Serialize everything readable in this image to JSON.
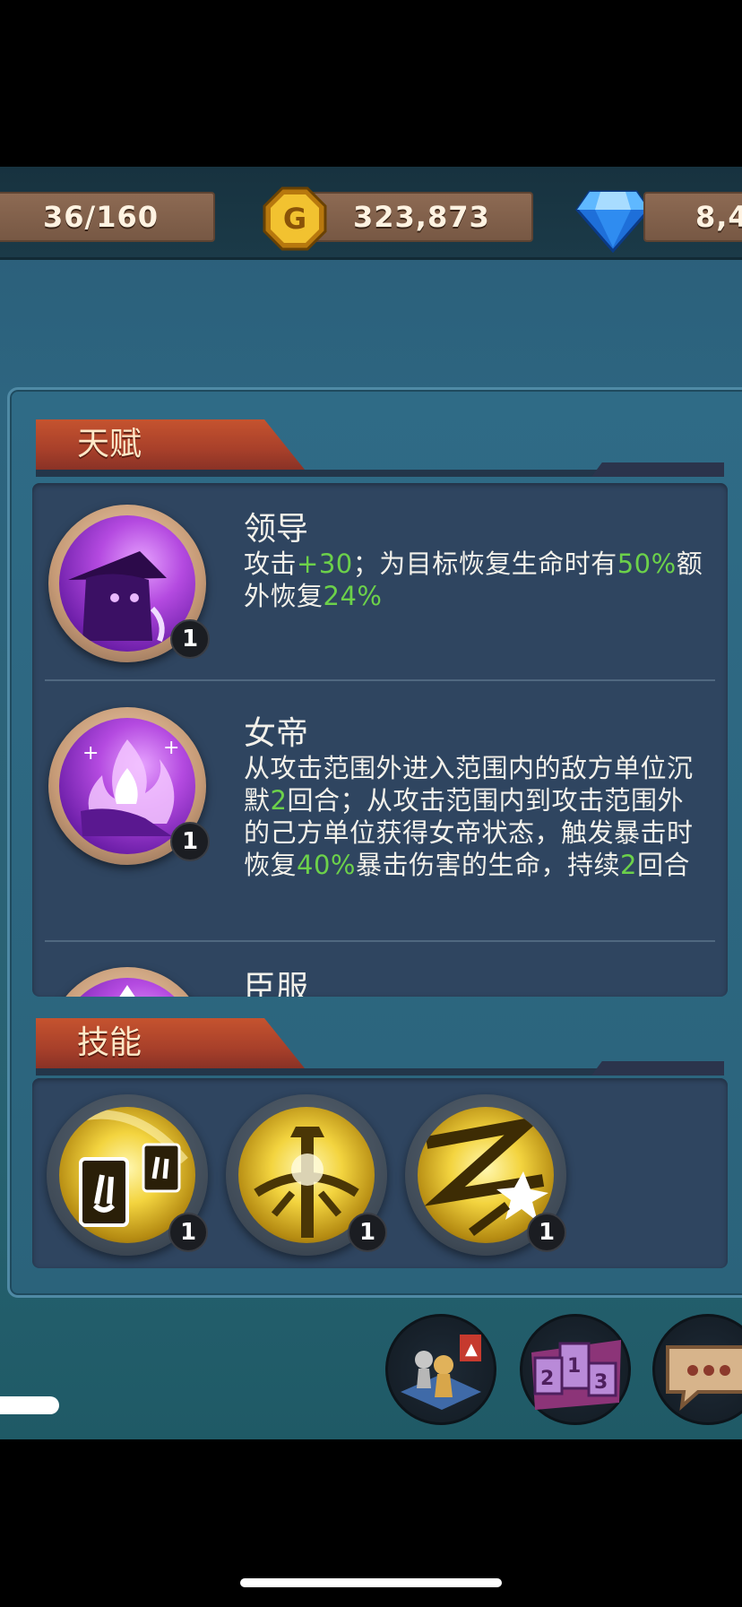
{
  "resources": {
    "stamina": "36/160",
    "gold": "323,873",
    "gems": "8,4"
  },
  "talents_section": {
    "title": "天赋",
    "items": [
      {
        "name": "领导",
        "level": "1",
        "desc": [
          {
            "t": "攻击",
            "hl": false
          },
          {
            "t": "+30",
            "hl": true
          },
          {
            "t": "；为目标恢复生命时有",
            "hl": false
          },
          {
            "t": "50%",
            "hl": true
          },
          {
            "t": "额外恢复",
            "hl": false
          },
          {
            "t": "24%",
            "hl": true
          }
        ]
      },
      {
        "name": "女帝",
        "level": "1",
        "desc": [
          {
            "t": "从攻击范围外进入范围内的敌方单位沉默",
            "hl": false
          },
          {
            "t": "2",
            "hl": true
          },
          {
            "t": "回合；从攻击范围内到攻击范围外的己方单位获得女帝状态，触发暴击时恢复",
            "hl": false
          },
          {
            "t": "40%",
            "hl": true
          },
          {
            "t": "暴击伤害的生命，持续",
            "hl": false
          },
          {
            "t": "2",
            "hl": true
          },
          {
            "t": "回合",
            "hl": false
          }
        ]
      },
      {
        "name": "臣服",
        "level": "",
        "desc": []
      }
    ]
  },
  "skills_section": {
    "title": "技能",
    "items": [
      {
        "level": "1",
        "icon": "cards-icon"
      },
      {
        "level": "1",
        "icon": "staff-icon"
      },
      {
        "level": "1",
        "icon": "burst-icon"
      }
    ]
  },
  "colors": {
    "highlight": "#6cd14a",
    "tab": "#b4462b",
    "panel": "#2f4560"
  }
}
